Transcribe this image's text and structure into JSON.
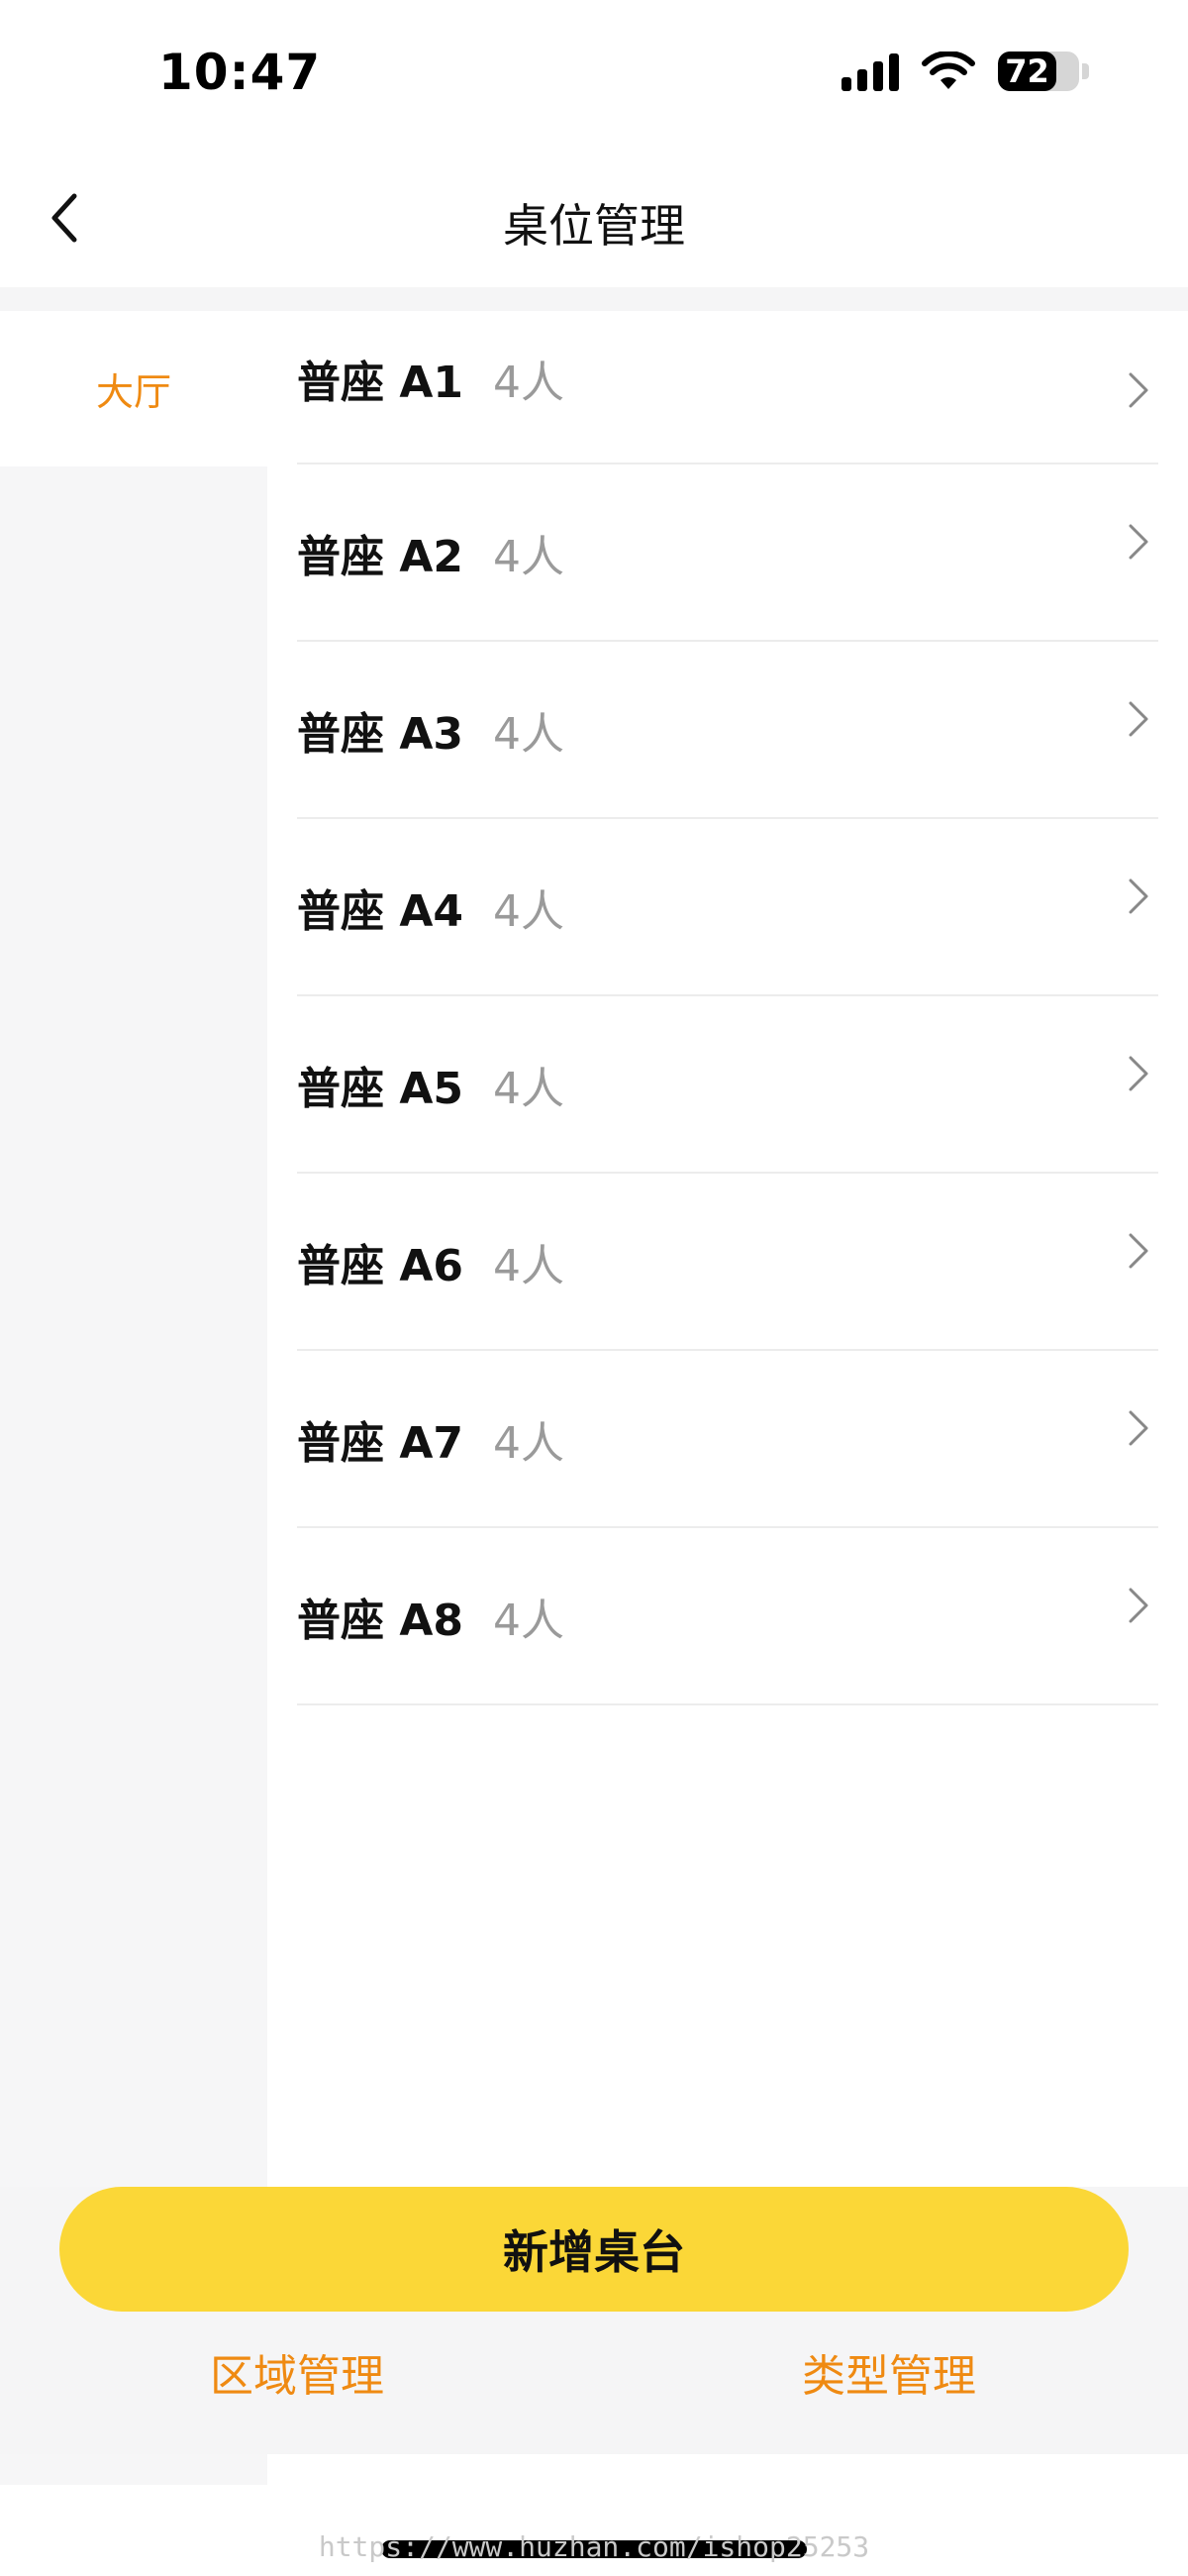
{
  "status_bar": {
    "time": "10:47",
    "battery_percent": 72,
    "battery_text": "72"
  },
  "nav": {
    "title": "桌位管理"
  },
  "sidebar": {
    "items": [
      {
        "label": "大厅",
        "selected": true
      }
    ],
    "accent_color": "#ef8a12"
  },
  "tables": [
    {
      "name": "普座 A1",
      "capacity": "4人"
    },
    {
      "name": "普座 A2",
      "capacity": "4人"
    },
    {
      "name": "普座 A3",
      "capacity": "4人"
    },
    {
      "name": "普座 A4",
      "capacity": "4人"
    },
    {
      "name": "普座 A5",
      "capacity": "4人"
    },
    {
      "name": "普座 A6",
      "capacity": "4人"
    },
    {
      "name": "普座 A7",
      "capacity": "4人"
    },
    {
      "name": "普座 A8",
      "capacity": "4人"
    }
  ],
  "actions": {
    "add_table": "新增桌台",
    "area_manage": "区域管理",
    "type_manage": "类型管理",
    "button_color": "#fbd737"
  },
  "watermark": "https://www.huzhan.com/ishop25253"
}
